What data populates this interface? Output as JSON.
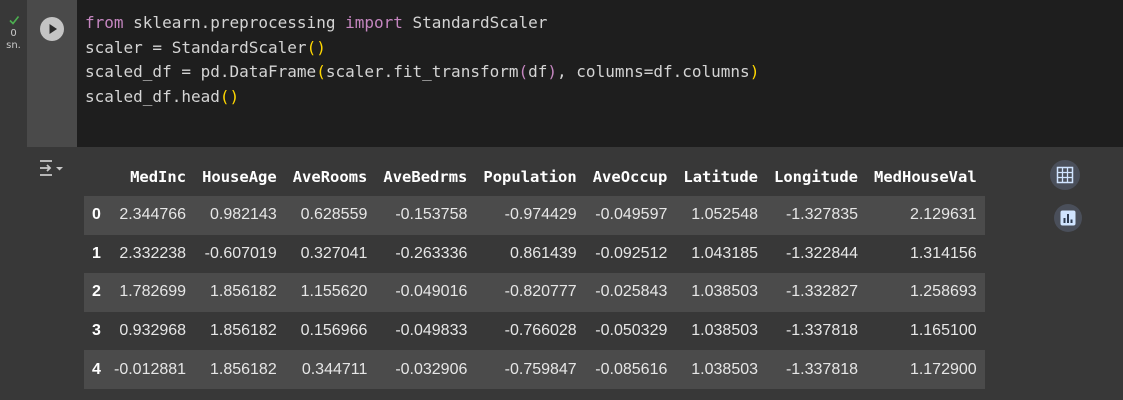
{
  "cell": {
    "exec_count": "0",
    "exec_unit": "sn.",
    "code_lines": [
      "from sklearn.preprocessing import StandardScaler",
      "scaler = StandardScaler()",
      "scaled_df = pd.DataFrame(scaler.fit_transform(df), columns=df.columns)",
      "scaled_df.head()"
    ]
  },
  "colors": {
    "keyword": "#c586c0",
    "bracket": "#ffd700",
    "check": "#4caf50"
  },
  "table": {
    "columns": [
      "MedInc",
      "HouseAge",
      "AveRooms",
      "AveBedrms",
      "Population",
      "AveOccup",
      "Latitude",
      "Longitude",
      "MedHouseVal"
    ],
    "rows": [
      {
        "index": "0",
        "values": [
          "2.344766",
          "0.982143",
          "0.628559",
          "-0.153758",
          "-0.974429",
          "-0.049597",
          "1.052548",
          "-1.327835",
          "2.129631"
        ]
      },
      {
        "index": "1",
        "values": [
          "2.332238",
          "-0.607019",
          "0.327041",
          "-0.263336",
          "0.861439",
          "-0.092512",
          "1.043185",
          "-1.322844",
          "1.314156"
        ]
      },
      {
        "index": "2",
        "values": [
          "1.782699",
          "1.856182",
          "1.155620",
          "-0.049016",
          "-0.820777",
          "-0.025843",
          "1.038503",
          "-1.332827",
          "1.258693"
        ]
      },
      {
        "index": "3",
        "values": [
          "0.932968",
          "1.856182",
          "0.156966",
          "-0.049833",
          "-0.766028",
          "-0.050329",
          "1.038503",
          "-1.337818",
          "1.165100"
        ]
      },
      {
        "index": "4",
        "values": [
          "-0.012881",
          "1.856182",
          "0.344711",
          "-0.032906",
          "-0.759847",
          "-0.085616",
          "1.038503",
          "-1.337818",
          "1.172900"
        ]
      }
    ]
  },
  "icons": {
    "run": "play-icon",
    "output_toggle": "output-collapse-icon",
    "table_view": "table-icon",
    "chart_suggest": "bar-chart-icon"
  }
}
